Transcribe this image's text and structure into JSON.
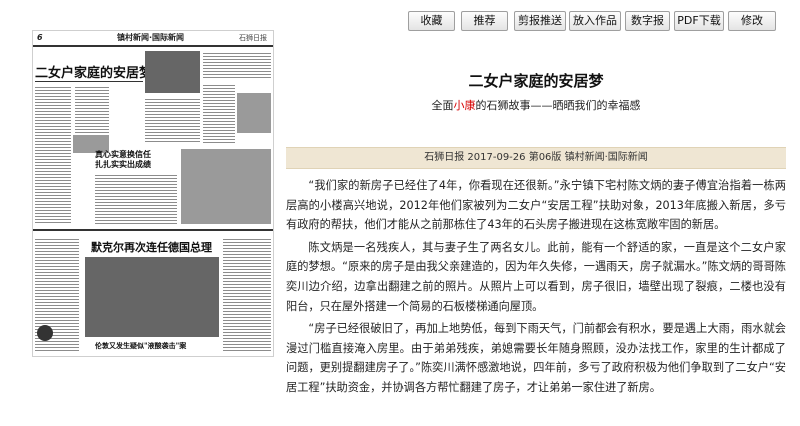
{
  "newspaper_thumbnail": {
    "page_number": "6",
    "section": "镇村新闻·国际新闻",
    "logo": "石狮日报",
    "headline_main": "二女户家庭的安居梦",
    "headline_mid": "真心实意换信任\n扎扎实实出成绩",
    "headline_intl": "默克尔再次连任德国总理",
    "headline_bottom": "伦敦又发生疑似\"液酸袭击\"案"
  },
  "toolbar": {
    "buttons": [
      "收藏",
      "推荐",
      "剪报推送",
      "放入作品",
      "数字报",
      "PDF下载",
      "修改"
    ]
  },
  "article": {
    "title": "二女户家庭的安居梦",
    "subtitle_before": "全面",
    "subtitle_highlight": "小康",
    "subtitle_after": "的石狮故事——晒晒我们的幸福感",
    "meta": "石狮日报  2017-09-26  第06版  镇村新闻·国际新闻",
    "paragraphs": [
      "“我们家的新房子已经住了4年，你看现在还很新。”永宁镇下宅村陈文炳的妻子傅宜治指着一栋两层高的小楼高兴地说，2012年他们家被列为二女户“安居工程”扶助对象，2013年底搬入新居，多亏有政府的帮扶，他们才能从之前那栋住了43年的石头房子搬进现在这栋宽敞牢固的新居。",
      "陈文炳是一名残疾人，其与妻子生了两名女儿。此前，能有一个舒适的家，一直是这个二女户家庭的梦想。“原来的房子是由我父亲建造的，因为年久失修，一遇雨天，房子就漏水。”陈文炳的哥哥陈奕川边介绍，边拿出翻建之前的照片。从照片上可以看到，房子很旧，墙壁出现了裂痕，二楼也没有阳台，只在屋外搭建一个简易的石板楼梯通向屋顶。",
      "“房子已经很破旧了，再加上地势低，每到下雨天气，门前都会有积水，要是遇上大雨，雨水就会漫过门槛直接淹入房里。由于弟弟残疾，弟媳需要长年随身照顾，没办法找工作，家里的生计都成了问题，更别提翻建房子了。”陈奕川满怀感激地说，四年前，多亏了政府积极为他们争取到了二女户“安居工程”扶助资金，并协调各方帮忙翻建了房子，才让弟弟一家住进了新房。"
    ]
  }
}
